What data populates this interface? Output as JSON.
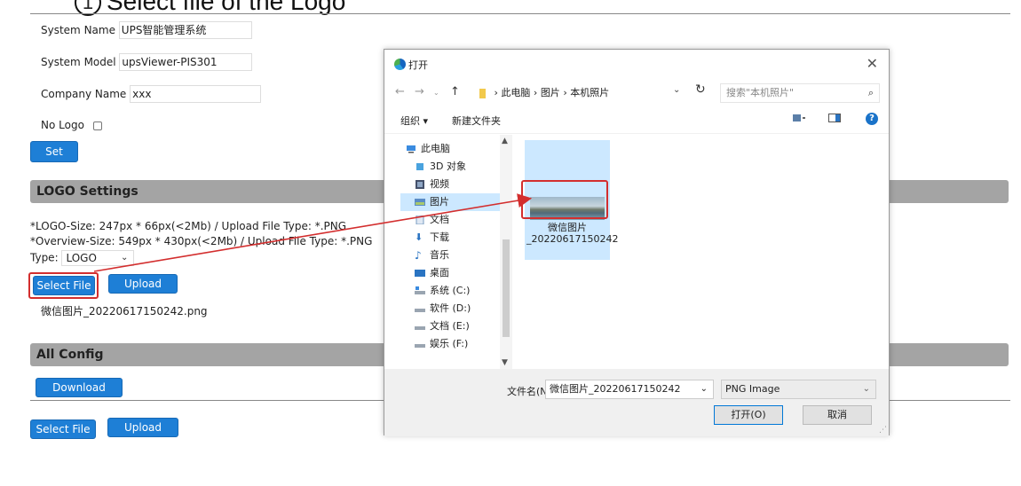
{
  "step": {
    "number": "1",
    "text": "Select file of the Logo"
  },
  "system": {
    "name_label": "System Name",
    "name_value": "UPS智能管理系统",
    "model_label": "System Model",
    "model_value": "upsViewer-PIS301",
    "company_label": "Company Name",
    "company_value": "xxx",
    "nologo_label": "No Logo",
    "set_button": "Set"
  },
  "logo_settings": {
    "title": "LOGO Settings",
    "spec_logo": "*LOGO-Size: 247px * 66px(<2Mb) / Upload File Type: *.PNG",
    "spec_overview": "*Overview-Size: 549px * 430px(<2Mb) / Upload File Type: *.PNG",
    "type_label": "Type:",
    "type_value": "LOGO",
    "select_file_button": "Select File",
    "upload_button": "Upload",
    "selected_file": "微信图片_20220617150242.png"
  },
  "all_config": {
    "title": "All Config",
    "download_button": "Download",
    "select_file_button": "Select File",
    "upload_button": "Upload"
  },
  "dialog": {
    "title": "打开",
    "breadcrumb": [
      "此电脑",
      "图片",
      "本机照片"
    ],
    "search_placeholder": "搜索\"本机照片\"",
    "toolbar_organize": "组织 ▾",
    "toolbar_new_folder": "新建文件夹",
    "nav_items": [
      "此电脑",
      "3D 对象",
      "视频",
      "图片",
      "文档",
      "下载",
      "音乐",
      "桌面",
      "系统 (C:)",
      "软件 (D:)",
      "文档 (E:)",
      "娱乐 (F:)"
    ],
    "selected_nav_item": "图片",
    "file_name": "微信图片_20220617150242",
    "filename_label": "文件名(N):",
    "filename_value": "微信图片_20220617150242",
    "filetype_value": "PNG Image",
    "open_button": "打开(O)",
    "cancel_button": "取消"
  },
  "colors": {
    "primary_button": "#1e7fd6",
    "section_bar": "#a4a4a4",
    "highlight_red": "#d32e2e",
    "selection_blue": "#cce8ff"
  }
}
